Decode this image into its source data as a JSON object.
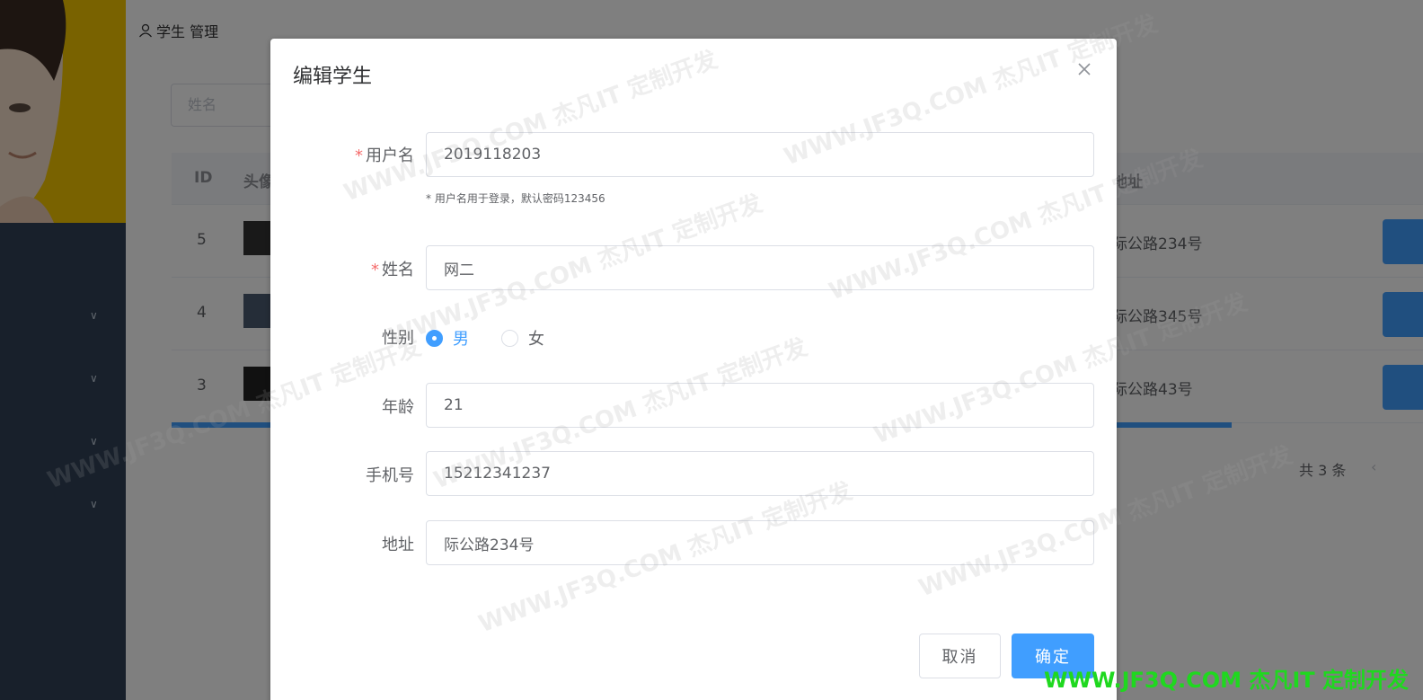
{
  "background": {
    "breadcrumb": "学生 管理",
    "search_placeholder": "姓名",
    "table": {
      "headers": [
        "ID",
        "头像",
        "地址"
      ],
      "rows": [
        {
          "id": "5",
          "address": "际公路234号"
        },
        {
          "id": "4",
          "address": "际公路345号"
        },
        {
          "id": "3",
          "address": "际公路43号"
        }
      ]
    },
    "pager_total": "共 3 条",
    "pager_prev": "‹"
  },
  "dialog": {
    "title": "编辑学生",
    "fields": {
      "username": {
        "label": "用户名",
        "value": "2019118203",
        "required": "*"
      },
      "username_hint": "* 用户名用于登录，默认密码123456",
      "name": {
        "label": "姓名",
        "value": "网二",
        "required": "*"
      },
      "gender": {
        "label": "性别",
        "options": [
          "男",
          "女"
        ],
        "selected": "男"
      },
      "age": {
        "label": "年龄",
        "value": "21"
      },
      "phone": {
        "label": "手机号",
        "value": "15212341237"
      },
      "address": {
        "label": "地址",
        "value": "际公路234号"
      }
    },
    "buttons": {
      "cancel": "取消",
      "confirm": "确定"
    }
  },
  "watermark": {
    "text": "WWW.JF3Q.COM 杰凡IT 定制开发",
    "corner": "WWW.JF3Q.COM 杰凡IT 定制开发"
  },
  "colors": {
    "primary": "#409eff",
    "required": "#f56c6c",
    "sidebar": "#304156",
    "avatar_bg": "#f2c400",
    "watermark_corner": "#1fd81f"
  }
}
